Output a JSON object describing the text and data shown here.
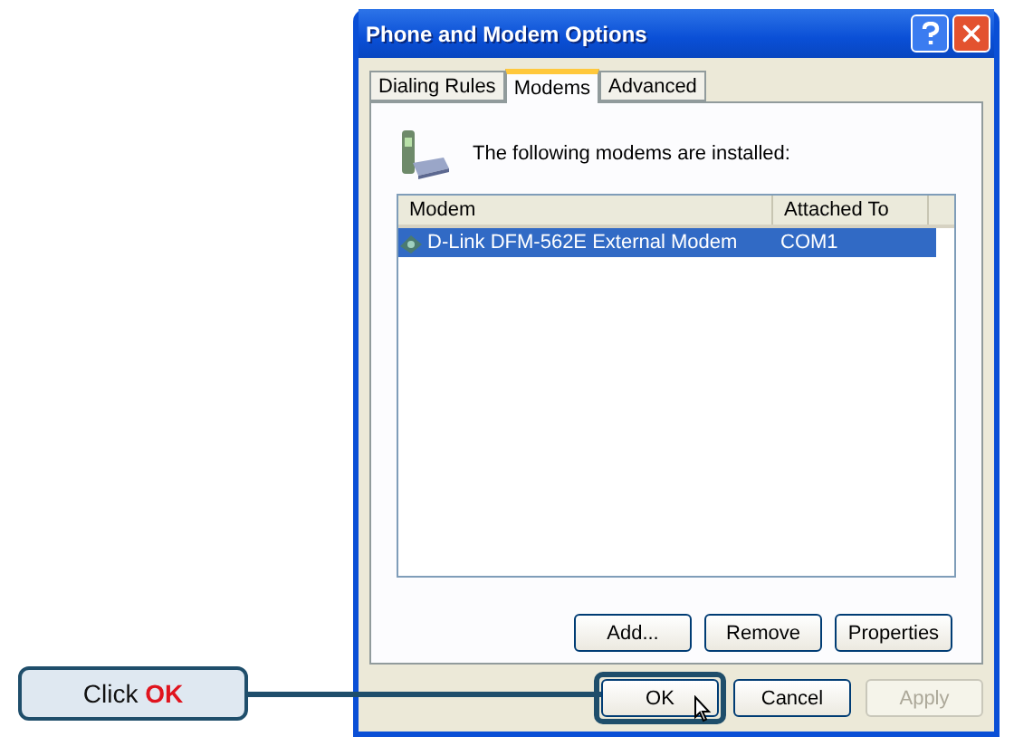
{
  "window": {
    "title": "Phone and Modem Options"
  },
  "tabs": [
    {
      "label": "Dialing Rules",
      "selected": false
    },
    {
      "label": "Modems",
      "selected": true
    },
    {
      "label": "Advanced",
      "selected": false
    }
  ],
  "intro": "The following modems are installed:",
  "table": {
    "columns": [
      "Modem",
      "Attached To"
    ],
    "rows": [
      {
        "cells": [
          "D-Link DFM-562E External Modem",
          "COM1"
        ],
        "selected": true
      }
    ]
  },
  "list_buttons": [
    "Add...",
    "Remove",
    "Properties"
  ],
  "dialog_buttons": [
    {
      "label": "OK",
      "disabled": false,
      "highlighted": true
    },
    {
      "label": "Cancel",
      "disabled": false,
      "highlighted": false
    },
    {
      "label": "Apply",
      "disabled": true,
      "highlighted": false
    }
  ],
  "callout": {
    "text": "Click **OK**"
  }
}
